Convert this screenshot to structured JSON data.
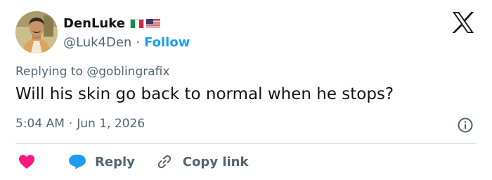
{
  "author": {
    "name": "DenLuke",
    "handle": "@Luk4Den",
    "separator": "·",
    "follow_label": "Follow",
    "flags": [
      "italy-flag",
      "usa-flag"
    ]
  },
  "reply_context": {
    "prefix": "Replying to",
    "mention": "@goblingrafix"
  },
  "tweet": {
    "text": "Will his skin go back to normal when he stops?",
    "time": "5:04 AM",
    "separator": "·",
    "date": "Jun 1, 2026"
  },
  "actions": {
    "like_icon": "heart-icon",
    "reply_label": "Reply",
    "copy_label": "Copy link"
  },
  "colors": {
    "accent": "#1d9bf0",
    "like": "#f91880",
    "text": "#0f1419",
    "muted": "#536471"
  }
}
